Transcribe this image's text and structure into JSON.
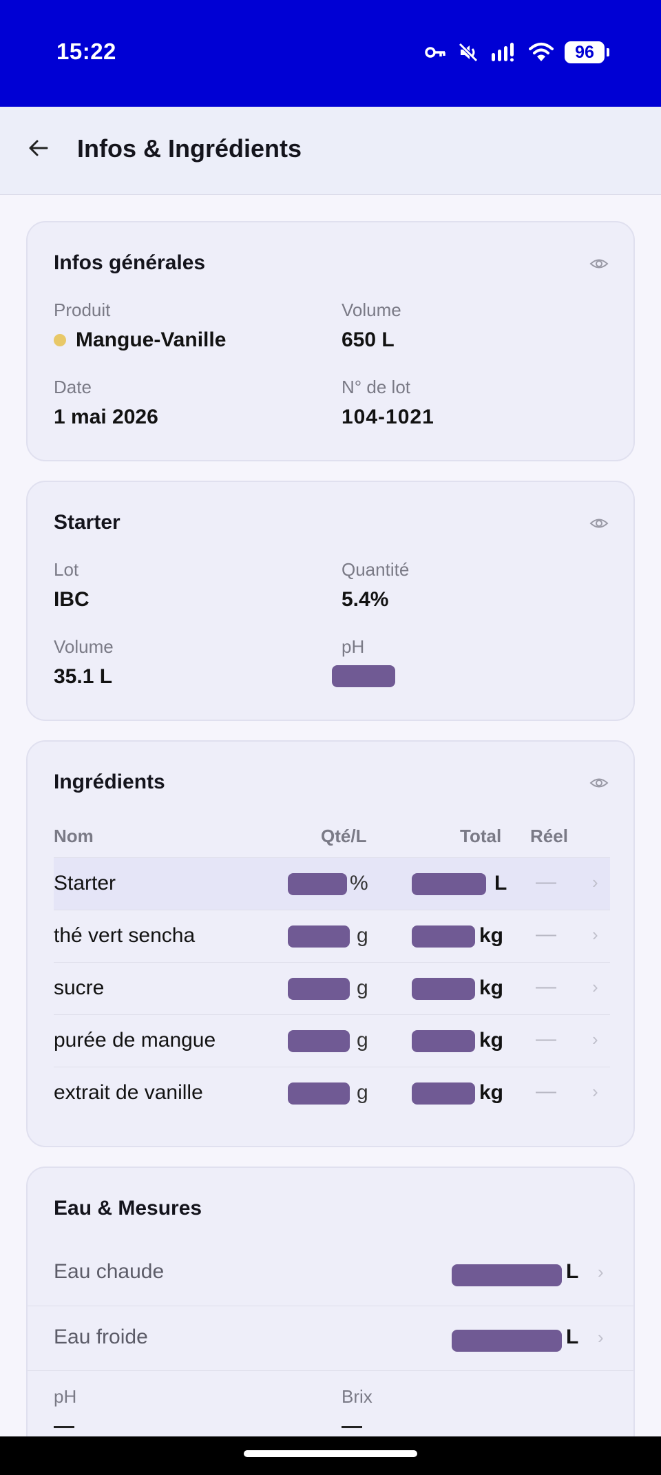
{
  "status_bar": {
    "time": "15:22",
    "battery": "96"
  },
  "app_bar": {
    "title": "Infos & Ingrédients"
  },
  "general": {
    "title": "Infos générales",
    "product_label": "Produit",
    "product_value": "Mangue-Vanille",
    "product_dot_color": "#e8c868",
    "volume_label": "Volume",
    "volume_value": "650 L",
    "date_label": "Date",
    "date_value": "1 mai 2026",
    "lot_label": "N° de lot",
    "lot_value": "104-1021"
  },
  "starter": {
    "title": "Starter",
    "lot_label": "Lot",
    "lot_value": "IBC",
    "qty_label": "Quantité",
    "qty_value": "5.4%",
    "volume_label": "Volume",
    "volume_value": "35.1 L",
    "ph_label": "pH"
  },
  "ingredients": {
    "title": "Ingrédients",
    "headers": {
      "name": "Nom",
      "qty": "Qté/L",
      "total": "Total",
      "real": "Réel"
    },
    "rows": [
      {
        "name": "Starter",
        "qty_unit": "%",
        "total_unit": "L",
        "real": "—"
      },
      {
        "name": "thé vert sencha",
        "qty_unit": "g",
        "total_unit": "kg",
        "real": "—"
      },
      {
        "name": "sucre",
        "qty_unit": "g",
        "total_unit": "kg",
        "real": "—"
      },
      {
        "name": "purée de mangue",
        "qty_unit": "g",
        "total_unit": "kg",
        "real": "—"
      },
      {
        "name": "extrait de vanille",
        "qty_unit": "g",
        "total_unit": "kg",
        "real": "—"
      }
    ]
  },
  "eau": {
    "title": "Eau & Mesures",
    "hot_label": "Eau chaude",
    "hot_unit": "L",
    "cold_label": "Eau froide",
    "cold_unit": "L",
    "ph_label": "pH",
    "brix_label": "Brix"
  },
  "colors": {
    "status_bar": "#0000d4",
    "redaction": "#705a94",
    "accent_dot": "#e8c868"
  }
}
